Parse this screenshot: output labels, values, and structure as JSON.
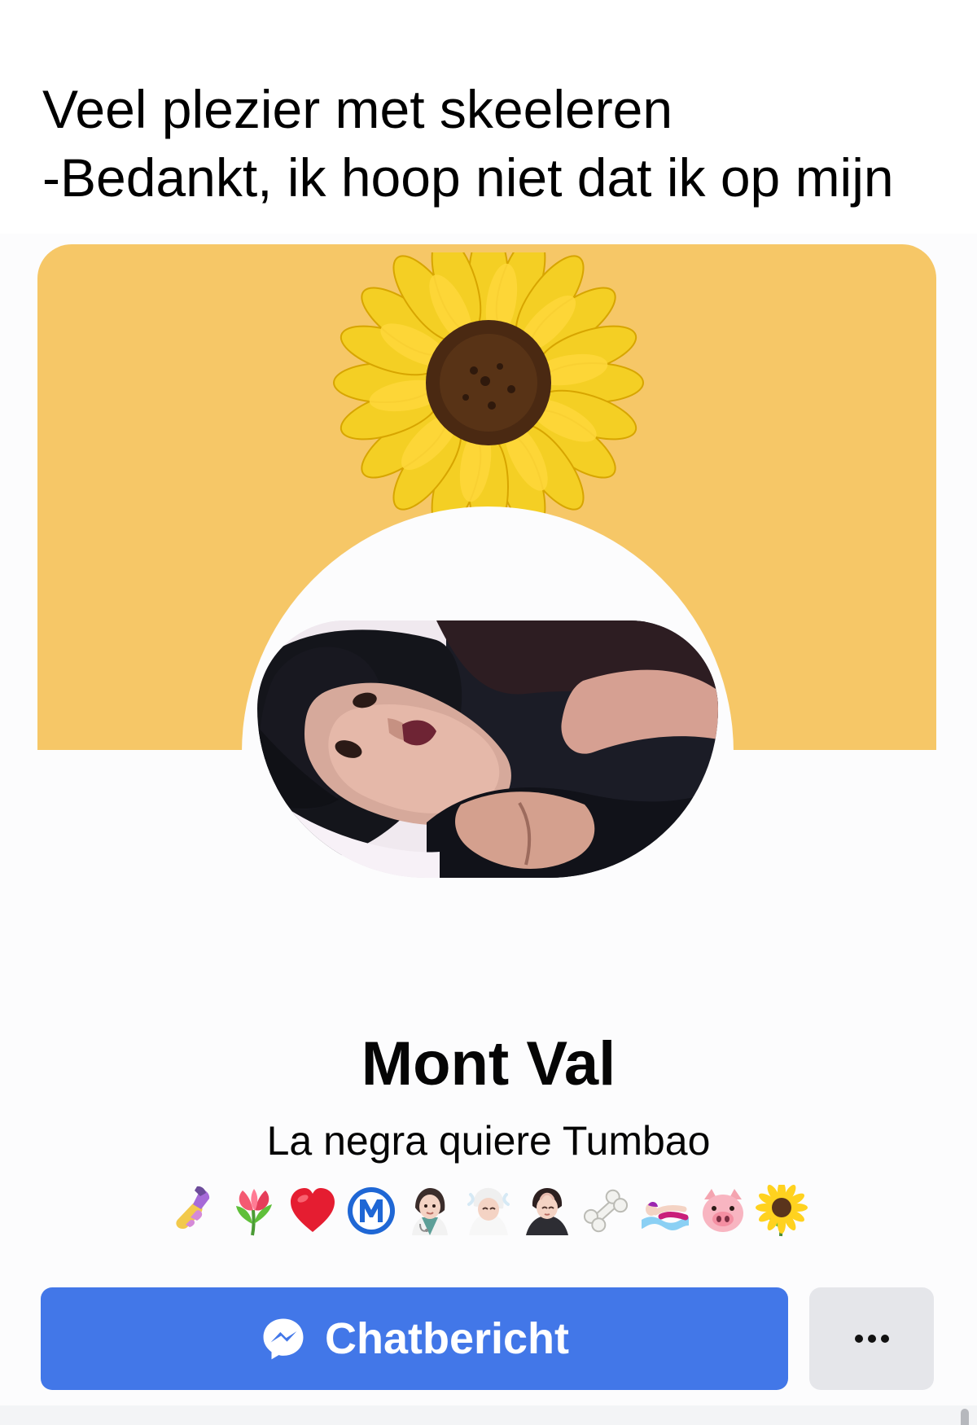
{
  "caption": {
    "line1": "Veel plezier met skeeleren",
    "line2": "-Bedankt, ik hoop niet dat ik op mijn"
  },
  "profile": {
    "name": "Mont Val",
    "bio": "La negra quiere Tumbao",
    "emoji_icons": [
      "nail-polish-icon",
      "tulip-icon",
      "red-heart-icon",
      "circled-m-icon",
      "health-worker-icon",
      "person-in-steamy-room-icon",
      "person-getting-massage-icon",
      "bone-icon",
      "person-swimming-icon",
      "pig-face-icon",
      "sunflower-icon"
    ],
    "cover_color": "#f6c767"
  },
  "actions": {
    "chat_label": "Chatbericht",
    "chat_icon": "messenger-icon",
    "chat_color": "#4277e8",
    "more_icon": "more-icon"
  }
}
